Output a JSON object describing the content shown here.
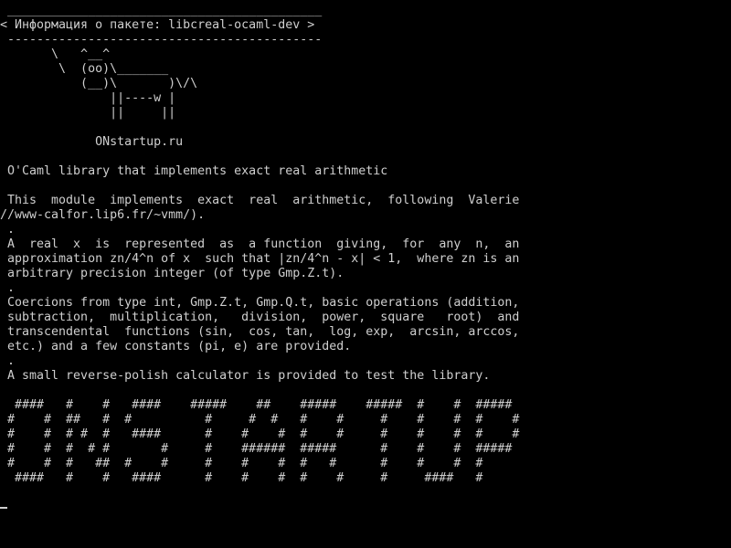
{
  "terminal": {
    "colors": {
      "background": "#000000",
      "foreground": "#cfcfcf"
    },
    "lines": [
      " ___________________________________________",
      "< Информация о пакете: libcreal-ocaml-dev >",
      " -------------------------------------------",
      "       \\   ^__^",
      "        \\  (oo)\\_______",
      "           (__)\\       )\\/\\",
      "               ||----w |",
      "               ||     ||",
      "",
      "             ONstartup.ru",
      "",
      " O'Caml library that implements exact real arithmetic",
      "",
      " This  module  implements  exact  real  arithmetic,  following  Valerie",
      "//www-calfor.lip6.fr/~vmm/).",
      " .",
      " A  real  x  is  represented  as  a function  giving,  for  any  n,  an",
      " approximation zn/4^n of x  such that |zn/4^n - x| < 1,  where zn is an",
      " arbitrary precision integer (of type Gmp.Z.t).",
      " .",
      " Coercions from type int, Gmp.Z.t, Gmp.Q.t, basic operations (addition,",
      " subtraction,  multiplication,   division,  power,  square   root)  and",
      " transcendental  functions (sin,  cos, tan,  log, exp,  arcsin, arccos,",
      " etc.) and a few constants (pi, e) are provided.",
      " .",
      " A small reverse-polish calculator is provided to test the library.",
      "",
      "  ####   #    #   ####    #####    ##    #####    #####  #    #  #####",
      " #    #  ##   #  #          #     #  #   #    #     #    #    #  #    #",
      " #    #  # #  #   ####      #    #    #  #    #     #    #    #  #    #",
      " #    #  #  # #       #     #    ######  #####      #    #    #  #####",
      " #    #  #   ##  #    #     #    #    #  #   #      #    #    #  #",
      "  ####   #    #   ####      #    #    #  #    #     #     ####   #"
    ]
  }
}
